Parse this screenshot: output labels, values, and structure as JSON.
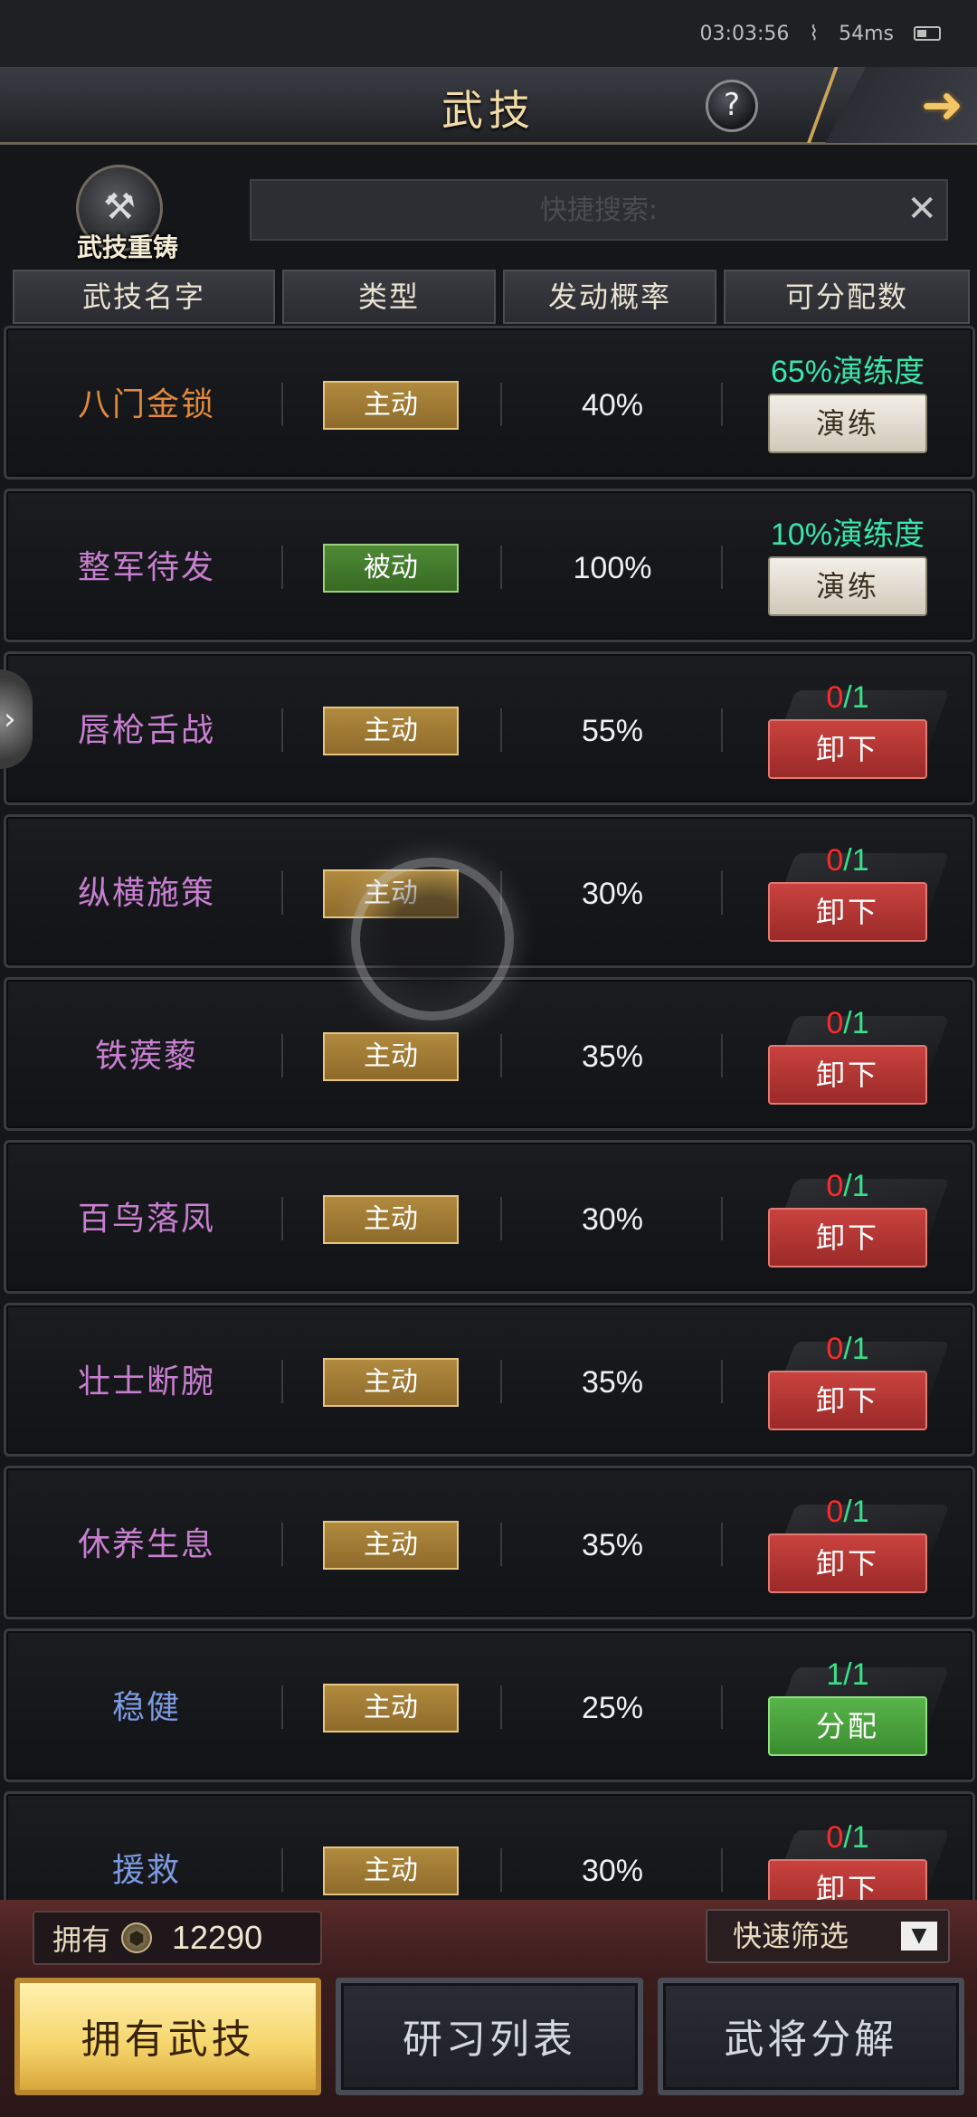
{
  "status_bar": {
    "time": "03:03:56",
    "ping": "54ms"
  },
  "header": {
    "title": "武技",
    "help_label": "?",
    "back_icon": "arrow-right-icon"
  },
  "reforge": {
    "label": "武技重铸",
    "icon": "anvil-icon"
  },
  "search": {
    "placeholder": "快捷搜索:",
    "value": "",
    "clear_label": "✕"
  },
  "columns": [
    "武技名字",
    "类型",
    "发动概率",
    "可分配数"
  ],
  "skills": [
    {
      "name": "八门金锁",
      "name_color": "#e0893e",
      "type": "主动",
      "type_kind": "active",
      "rate": "40%",
      "alloc_text": "65%演练度",
      "alloc_color": "#39e5a8",
      "button": "演练",
      "button_kind": "train"
    },
    {
      "name": "整军待发",
      "name_color": "#c77fcf",
      "type": "被动",
      "type_kind": "passive",
      "rate": "100%",
      "alloc_text": "10%演练度",
      "alloc_color": "#39e5a8",
      "button": "演练",
      "button_kind": "train"
    },
    {
      "name": "唇枪舌战",
      "name_color": "#c77fcf",
      "type": "主动",
      "type_kind": "active",
      "rate": "55%",
      "alloc_used": "0",
      "alloc_total": "1",
      "alloc_used_color": "#ff2a2a",
      "button": "卸下",
      "button_kind": "unload"
    },
    {
      "name": "纵横施策",
      "name_color": "#c77fcf",
      "type": "主动",
      "type_kind": "active",
      "rate": "30%",
      "alloc_used": "0",
      "alloc_total": "1",
      "alloc_used_color": "#ff2a2a",
      "button": "卸下",
      "button_kind": "unload"
    },
    {
      "name": "铁蒺藜",
      "name_color": "#c77fcf",
      "type": "主动",
      "type_kind": "active",
      "rate": "35%",
      "alloc_used": "0",
      "alloc_total": "1",
      "alloc_used_color": "#ff2a2a",
      "button": "卸下",
      "button_kind": "unload"
    },
    {
      "name": "百鸟落凤",
      "name_color": "#c77fcf",
      "type": "主动",
      "type_kind": "active",
      "rate": "30%",
      "alloc_used": "0",
      "alloc_total": "1",
      "alloc_used_color": "#ff2a2a",
      "button": "卸下",
      "button_kind": "unload"
    },
    {
      "name": "壮士断腕",
      "name_color": "#c77fcf",
      "type": "主动",
      "type_kind": "active",
      "rate": "35%",
      "alloc_used": "0",
      "alloc_total": "1",
      "alloc_used_color": "#ff2a2a",
      "button": "卸下",
      "button_kind": "unload"
    },
    {
      "name": "休养生息",
      "name_color": "#c77fcf",
      "type": "主动",
      "type_kind": "active",
      "rate": "35%",
      "alloc_used": "0",
      "alloc_total": "1",
      "alloc_used_color": "#ff2a2a",
      "button": "卸下",
      "button_kind": "unload"
    },
    {
      "name": "稳健",
      "name_color": "#7c9ae0",
      "type": "主动",
      "type_kind": "active",
      "rate": "25%",
      "alloc_used": "1",
      "alloc_total": "1",
      "alloc_used_color": "#38e08a",
      "button": "分配",
      "button_kind": "assign"
    },
    {
      "name": "援救",
      "name_color": "#7c9ae0",
      "type": "主动",
      "type_kind": "active",
      "rate": "30%",
      "alloc_used": "0",
      "alloc_total": "1",
      "alloc_used_color": "#ff2a2a",
      "button": "卸下",
      "button_kind": "unload"
    }
  ],
  "bottom": {
    "owned_label": "拥有",
    "owned_amount": "12290",
    "filter_label": "快速筛选",
    "tabs": [
      "拥有武技",
      "研习列表",
      "武将分解"
    ],
    "selected_tab": 0
  }
}
